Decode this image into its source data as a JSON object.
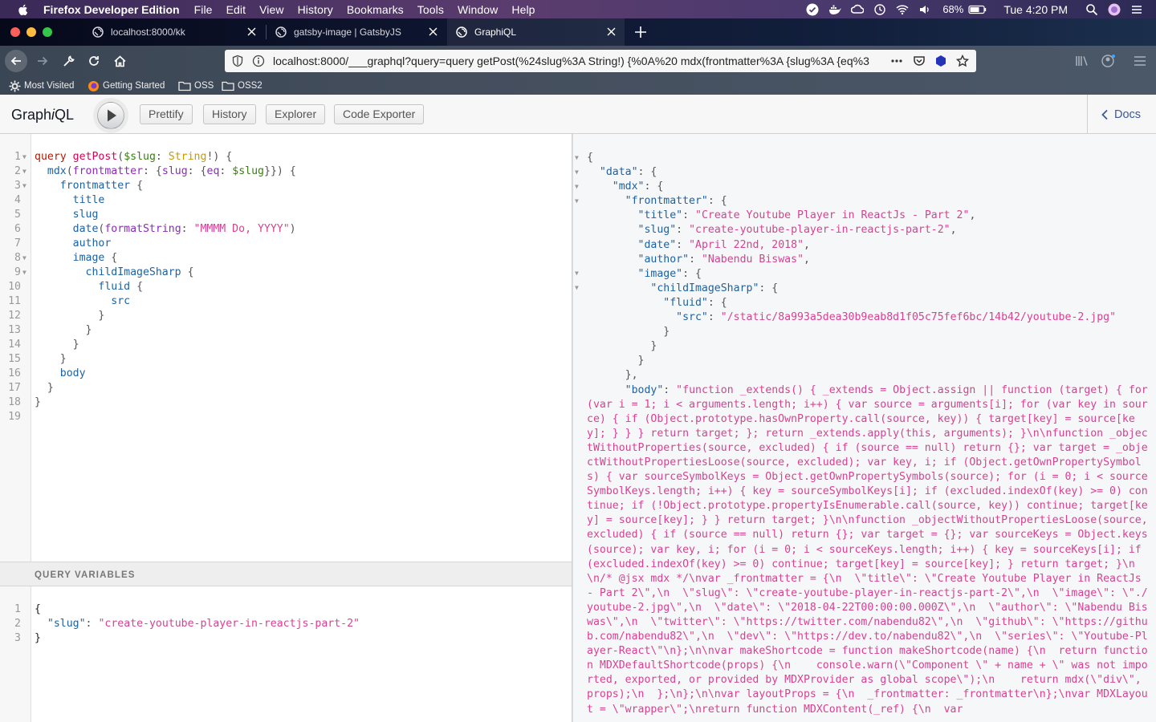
{
  "menubar": {
    "app_name": "Firefox Developer Edition",
    "items": [
      "File",
      "Edit",
      "View",
      "History",
      "Bookmarks",
      "Tools",
      "Window",
      "Help"
    ],
    "battery": "68%",
    "clock": "Tue 4:20 PM"
  },
  "tabs": [
    {
      "title": "localhost:8000/kk"
    },
    {
      "title": "gatsby-image | GatsbyJS"
    },
    {
      "title": "GraphiQL"
    }
  ],
  "urlbar": {
    "url": "localhost:8000/___graphql?query=query getPost(%24slug%3A String!) {%0A%20 mdx(frontmatter%3A {slug%3A {eq%3"
  },
  "bookmarks": [
    "Most Visited",
    "Getting Started",
    "OSS",
    "OSS2"
  ],
  "graphiql": {
    "title_pre": "Graph",
    "title_it": "i",
    "title_post": "QL",
    "buttons": {
      "prettify": "Prettify",
      "history": "History",
      "explorer": "Explorer",
      "code_exporter": "Code Exporter"
    },
    "docs": "Docs",
    "vars_header": "QUERY VARIABLES"
  },
  "query_lines": [
    "query getPost($slug: String!) {",
    "  mdx(frontmatter: {slug: {eq: $slug}}) {",
    "    frontmatter {",
    "      title",
    "      slug",
    "      date(formatString: \"MMMM Do, YYYY\")",
    "      author",
    "      image {",
    "        childImageSharp {",
    "          fluid {",
    "            src",
    "          }",
    "        }",
    "      }",
    "    }",
    "    body",
    "  }",
    "}",
    ""
  ],
  "variables_lines": [
    "{",
    "  \"slug\": \"create-youtube-player-in-reactjs-part-2\"",
    "}"
  ],
  "result": {
    "frontmatter": {
      "title": "Create Youtube Player in ReactJs - Part 2",
      "slug": "create-youtube-player-in-reactjs-part-2",
      "date": "April 22nd, 2018",
      "author": "Nabendu Biswas",
      "src": "/static/8a993a5dea30b9eab8d1f05c75fef6bc/14b42/youtube-2.jpg"
    },
    "body": "function _extends() { _extends = Object.assign || function (target) { for (var i = 1; i < arguments.length; i++) { var source = arguments[i]; for (var key in source) { if (Object.prototype.hasOwnProperty.call(source, key)) { target[key] = source[key]; } } } return target; }; return _extends.apply(this, arguments); }\\n\\nfunction _objectWithoutProperties(source, excluded) { if (source == null) return {}; var target = _objectWithoutPropertiesLoose(source, excluded); var key, i; if (Object.getOwnPropertySymbols) { var sourceSymbolKeys = Object.getOwnPropertySymbols(source); for (i = 0; i < sourceSymbolKeys.length; i++) { key = sourceSymbolKeys[i]; if (excluded.indexOf(key) >= 0) continue; if (!Object.prototype.propertyIsEnumerable.call(source, key)) continue; target[key] = source[key]; } } return target; }\\n\\nfunction _objectWithoutPropertiesLoose(source, excluded) { if (source == null) return {}; var target = {}; var sourceKeys = Object.keys(source); var key, i; for (i = 0; i < sourceKeys.length; i++) { key = sourceKeys[i]; if (excluded.indexOf(key) >= 0) continue; target[key] = source[key]; } return target; }\\n\\n/* @jsx mdx */\\nvar _frontmatter = {\\n  \\\"title\\\": \\\"Create Youtube Player in ReactJs - Part 2\\\",\\n  \\\"slug\\\": \\\"create-youtube-player-in-reactjs-part-2\\\",\\n  \\\"image\\\": \\\"./youtube-2.jpg\\\",\\n  \\\"date\\\": \\\"2018-04-22T00:00:00.000Z\\\",\\n  \\\"author\\\": \\\"Nabendu Biswas\\\",\\n  \\\"twitter\\\": \\\"https://twitter.com/nabendu82\\\",\\n  \\\"github\\\": \\\"https://github.com/nabendu82\\\",\\n  \\\"dev\\\": \\\"https://dev.to/nabendu82\\\",\\n  \\\"series\\\": \\\"Youtube-Player-React\\\"\\n};\\n\\nvar makeShortcode = function makeShortcode(name) {\\n  return function MDXDefaultShortcode(props) {\\n    console.warn(\\\"Component \\\" + name + \\\" was not imported, exported, or provided by MDXProvider as global scope\\\");\\n    return mdx(\\\"div\\\", props);\\n  };\\n};\\n\\nvar layoutProps = {\\n  _frontmatter: _frontmatter\\n};\\nvar MDXLayout = \\\"wrapper\\\";\\nreturn function MDXContent(_ref) {\\n  var"
  }
}
